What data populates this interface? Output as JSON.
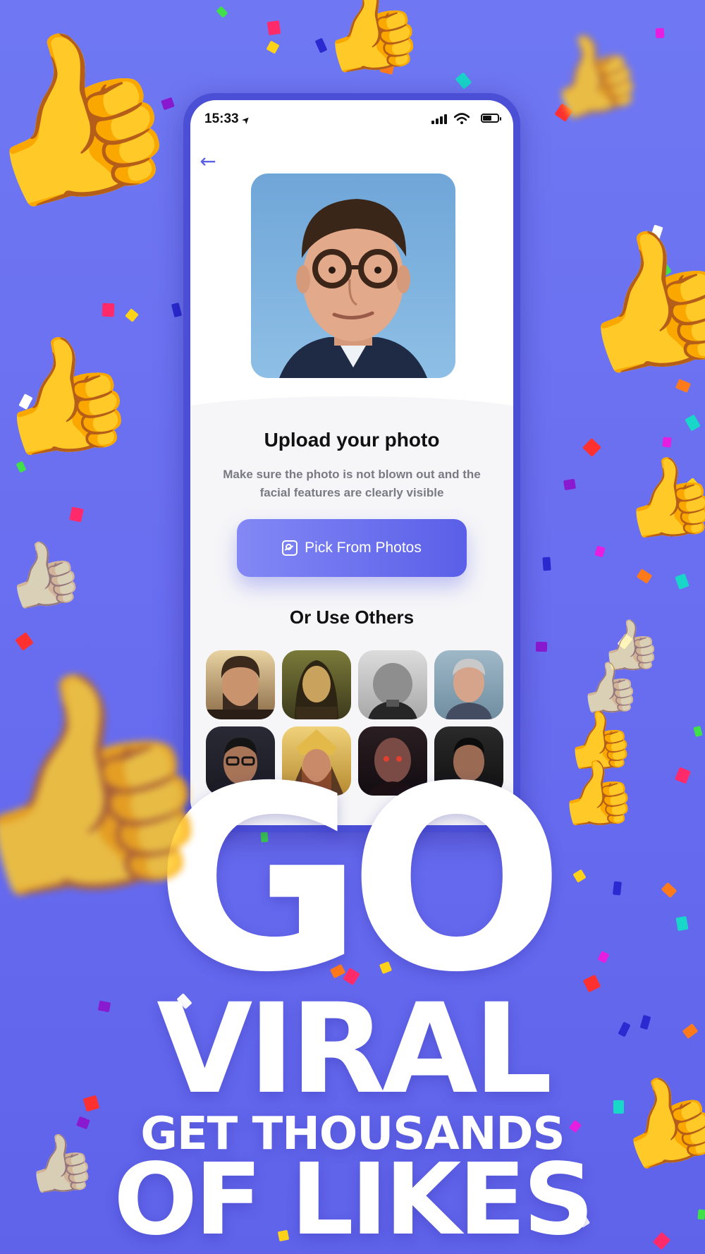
{
  "colors": {
    "background": "#6a6ef0",
    "accent": "#5b60e6",
    "phone_frame": "#4b4fd6",
    "thumb": "#f4c43c"
  },
  "icons": {
    "thumbs_up": "👍",
    "back_arrow": "←",
    "location_arrow": "➤",
    "wifi": "wifi-icon",
    "signal": "signal-icon",
    "battery": "battery-icon",
    "photo": "photo-icon"
  },
  "status_bar": {
    "time": "15:33"
  },
  "upload": {
    "title": "Upload your photo",
    "subtitle": "Make sure the photo is not blown out and the facial features are clearly visible",
    "pick_button_label": "Pick From Photos"
  },
  "others": {
    "title": "Or Use Others",
    "faces": [
      "face-rugged-man",
      "face-mona-lisa",
      "face-churchill",
      "face-grey-hair-man",
      "face-man-glasses",
      "face-warrior-helmet",
      "face-bald-demon",
      "face-dark-man"
    ]
  },
  "headline": {
    "line1": "GO",
    "line2": "VIRAL",
    "line3": "GET THOUSANDS",
    "line4": "OF LIKES"
  }
}
